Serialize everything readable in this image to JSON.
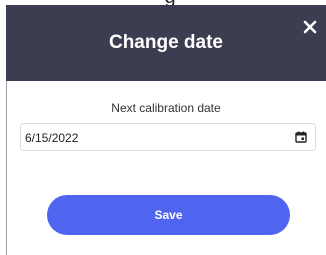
{
  "background": {
    "partial_text": "g"
  },
  "modal": {
    "title": "Change date",
    "close_icon": "close-icon",
    "field_label": "Next calibration date",
    "date_value": "6/15/2022",
    "calendar_icon": "calendar-icon",
    "save_label": "Save",
    "colors": {
      "header_bg": "#3c3d50",
      "accent": "#4f65f0",
      "title_text": "#ffffff"
    }
  }
}
